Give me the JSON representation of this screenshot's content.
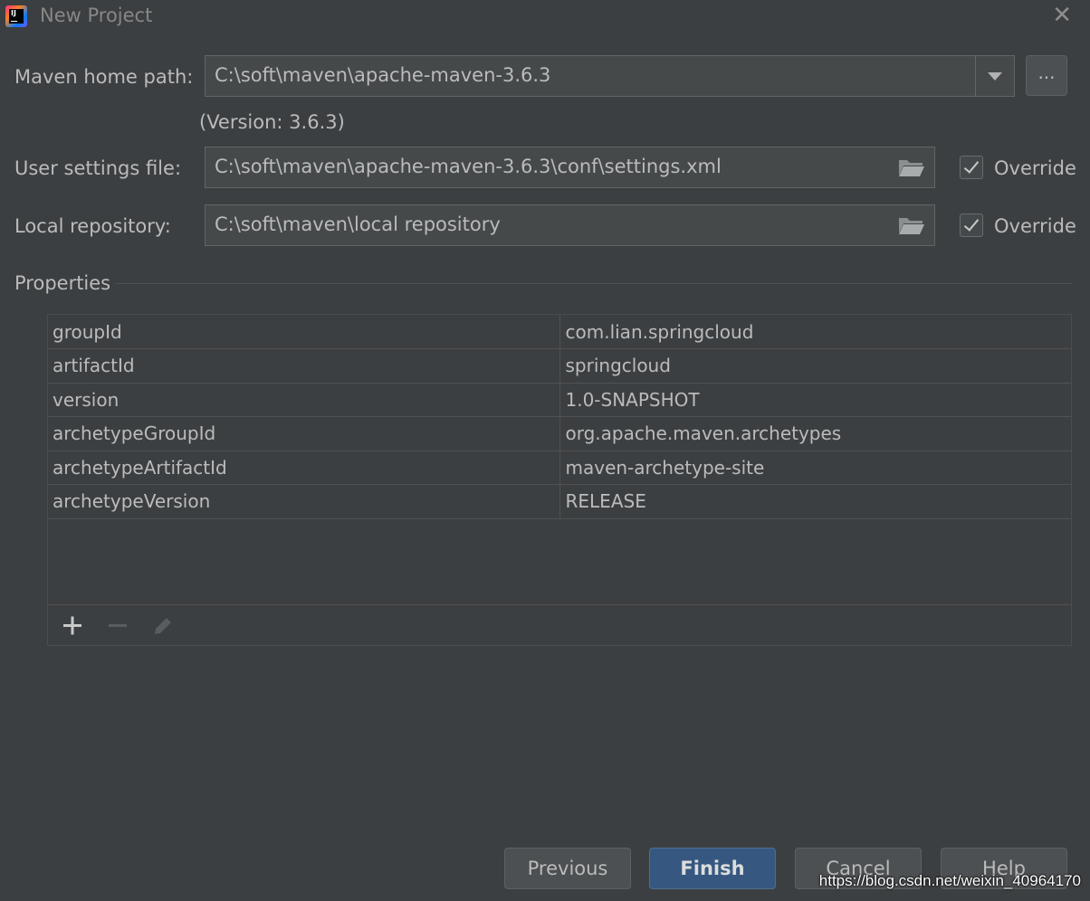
{
  "window": {
    "title": "New Project",
    "logo_text": "IJ"
  },
  "form": {
    "maven_home_label": "Maven home path:",
    "maven_home_value": "C:\\soft\\maven\\apache-maven-3.6.3",
    "browse_label": "...",
    "version_text": "(Version: 3.6.3)",
    "user_settings_label": "User settings file:",
    "user_settings_value": "C:\\soft\\maven\\apache-maven-3.6.3\\conf\\settings.xml",
    "user_settings_override_label": "Override",
    "user_settings_override_checked": true,
    "local_repo_label": "Local repository:",
    "local_repo_value": "C:\\soft\\maven\\local repository",
    "local_repo_override_label": "Override",
    "local_repo_override_checked": true
  },
  "properties": {
    "title": "Properties",
    "rows": [
      {
        "key": "groupId",
        "value": "com.lian.springcloud"
      },
      {
        "key": "artifactId",
        "value": "springcloud"
      },
      {
        "key": "version",
        "value": "1.0-SNAPSHOT"
      },
      {
        "key": "archetypeGroupId",
        "value": "org.apache.maven.archetypes"
      },
      {
        "key": "archetypeArtifactId",
        "value": "maven-archetype-site"
      },
      {
        "key": "archetypeVersion",
        "value": "RELEASE"
      }
    ],
    "toolbar_icons": [
      "plus-icon",
      "minus-icon",
      "pencil-icon"
    ]
  },
  "buttons": {
    "previous": "Previous",
    "finish": "Finish",
    "cancel": "Cancel",
    "help": "Help"
  },
  "watermark": "https://blog.csdn.net/weixin_40964170",
  "colors": {
    "background": "#3c3f41",
    "field_bg": "#45494a",
    "primary_button": "#365880",
    "text": "#bbbbbb"
  }
}
